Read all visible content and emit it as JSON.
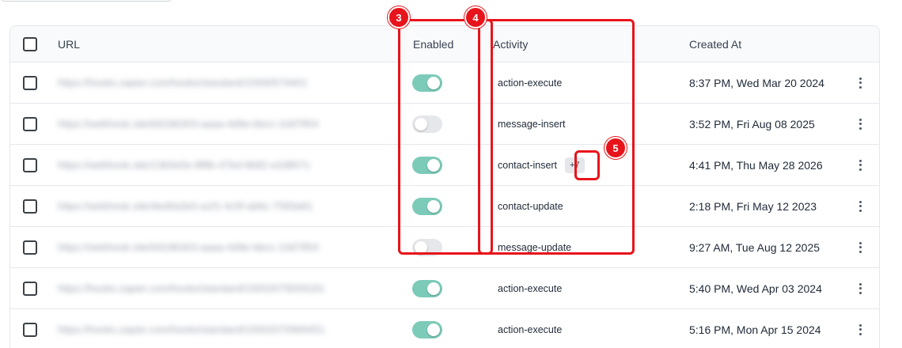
{
  "table": {
    "headers": {
      "url": "URL",
      "enabled": "Enabled",
      "activity": "Activity",
      "created_at": "Created At"
    },
    "rows": [
      {
        "url": "https://hooks.zapier.com/hooks/standard/15930579401",
        "enabled": true,
        "activity": "action-execute",
        "more": "",
        "created_at": "8:37 PM, Wed Mar 20 2024"
      },
      {
        "url": "https://webhook.site/b9186303-aaaa-4d9e-bbcc-10d7854",
        "enabled": false,
        "activity": "message-insert",
        "more": "",
        "created_at": "3:52 PM, Fri Aug 08 2025"
      },
      {
        "url": "https://webhook.site/13b5e0e-8f8b-47bd-9b82-e2d807c",
        "enabled": true,
        "activity": "contact-insert",
        "more": "+7",
        "created_at": "4:41 PM, Thu May 28 2026"
      },
      {
        "url": "https://webhook.site/ded0a3e5-a1f1-4c5f-ab6c-7583a81",
        "enabled": true,
        "activity": "contact-update",
        "more": "",
        "created_at": "2:18 PM, Fri May 12 2023"
      },
      {
        "url": "https://webhook.site/b9186303-aaaa-4d9e-bbcc-10d7854",
        "enabled": false,
        "activity": "message-update",
        "more": "",
        "created_at": "9:27 AM, Tue Aug 12 2025"
      },
      {
        "url": "https://hooks.zapier.com/hooks/standard/15932079009181",
        "enabled": true,
        "activity": "action-execute",
        "more": "",
        "created_at": "5:40 PM, Wed Apr 03 2024"
      },
      {
        "url": "https://hooks.zapier.com/hooks/standard/15932070969451",
        "enabled": true,
        "activity": "action-execute",
        "more": "",
        "created_at": "5:16 PM, Mon Apr 15 2024"
      }
    ]
  },
  "annotations": {
    "badge_3": "3",
    "badge_4": "4",
    "badge_5": "5",
    "highlight_color": "#e8141b"
  },
  "colors": {
    "toggle_on": "#7ccbb9",
    "toggle_off": "#e5e7eb"
  }
}
